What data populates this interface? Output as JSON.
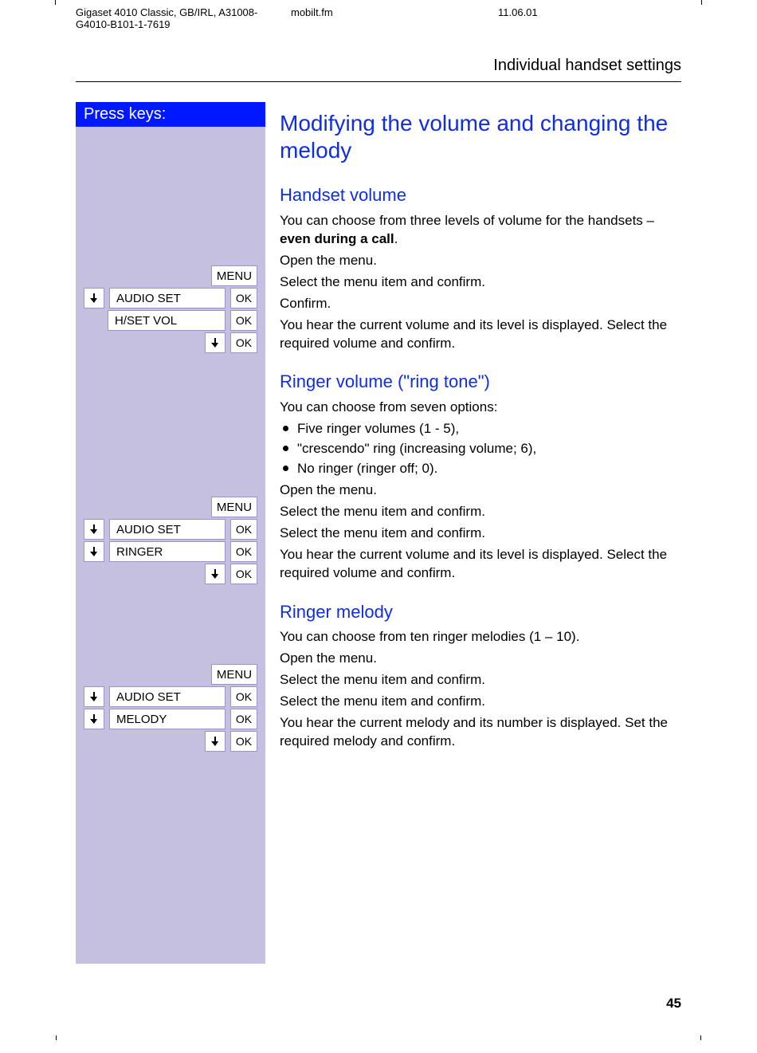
{
  "header": {
    "left": "Gigaset 4010 Classic, GB/IRL, A31008-G4010-B101-1-7619",
    "mid": "mobilt.fm",
    "right": "11.06.01"
  },
  "section_title": "Individual handset settings",
  "press_keys_label": "Press keys:",
  "keys": {
    "menu": "MENU",
    "ok": "OK",
    "audio_set": "AUDIO SET",
    "hset_vol": "H/SET VOL",
    "ringer": "RINGER",
    "melody": "MELODY"
  },
  "content": {
    "h1": "Modifying the volume and changing the melody",
    "handset_volume": {
      "title": "Handset volume",
      "intro_a": "You can choose from three levels of volume for the handsets  –  ",
      "intro_b": "even during a call",
      "intro_c": ".",
      "r_menu": "Open the menu.",
      "r_audio": "Select the menu item and confirm.",
      "r_hset": "Confirm.",
      "r_ok": "You hear the current volume and its level is displayed. Select the required volume and confirm."
    },
    "ringer_volume": {
      "title": "Ringer volume (\"ring tone\")",
      "intro": "You can choose from seven options:",
      "b1": "Five ringer volumes (1  - 5),",
      "b2": "\"crescendo\" ring (increasing volume; 6),",
      "b3": "No ringer (ringer off; 0).",
      "r_menu": "Open the menu.",
      "r_audio": "Select the menu item and confirm.",
      "r_ringer": "Select the menu item and confirm.",
      "r_ok": "You hear the current volume and its level is displayed. Select the required volume and confirm."
    },
    "ringer_melody": {
      "title": "Ringer melody",
      "intro": "You can choose from ten ringer melodies (1 – 10).",
      "r_menu": "Open the menu.",
      "r_audio": "Select the menu item and confirm.",
      "r_melody": "Select the menu item and confirm.",
      "r_ok": "You hear the current melody and its number is displayed. Set the required melody and confirm."
    }
  },
  "page_number": "45"
}
